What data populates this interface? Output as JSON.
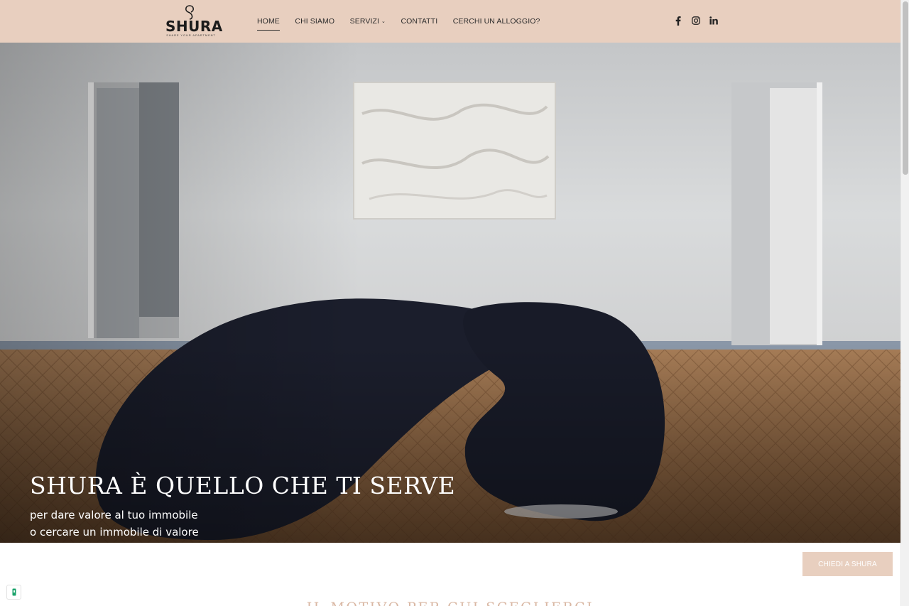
{
  "brand": {
    "name": "SHURA",
    "tagline": "SHARE YOUR APARTMENT"
  },
  "nav": {
    "items": [
      {
        "label": "HOME",
        "active": true
      },
      {
        "label": "CHI SIAMO",
        "active": false
      },
      {
        "label": "SERVIZI",
        "active": false,
        "has_dropdown": true
      },
      {
        "label": "CONTATTI",
        "active": false
      },
      {
        "label": "CERCHI UN ALLOGGIO?",
        "active": false
      }
    ],
    "social": [
      "facebook-icon",
      "instagram-icon",
      "linkedin-icon"
    ]
  },
  "hero": {
    "title": "SHURA È QUELLO CHE TI SERVE",
    "subtitle_line1": "per dare valore al tuo immobile",
    "subtitle_line2": "o cercare un immobile di valore"
  },
  "cta": {
    "label": "CHIEDI A SHURA"
  },
  "section": {
    "heading": "IL MOTIVO PER CUI SCEGLIERCI"
  },
  "colors": {
    "header_bg": "#e8cfbf",
    "accent": "#d9b7a3",
    "text_dark": "#2b2b2b"
  }
}
